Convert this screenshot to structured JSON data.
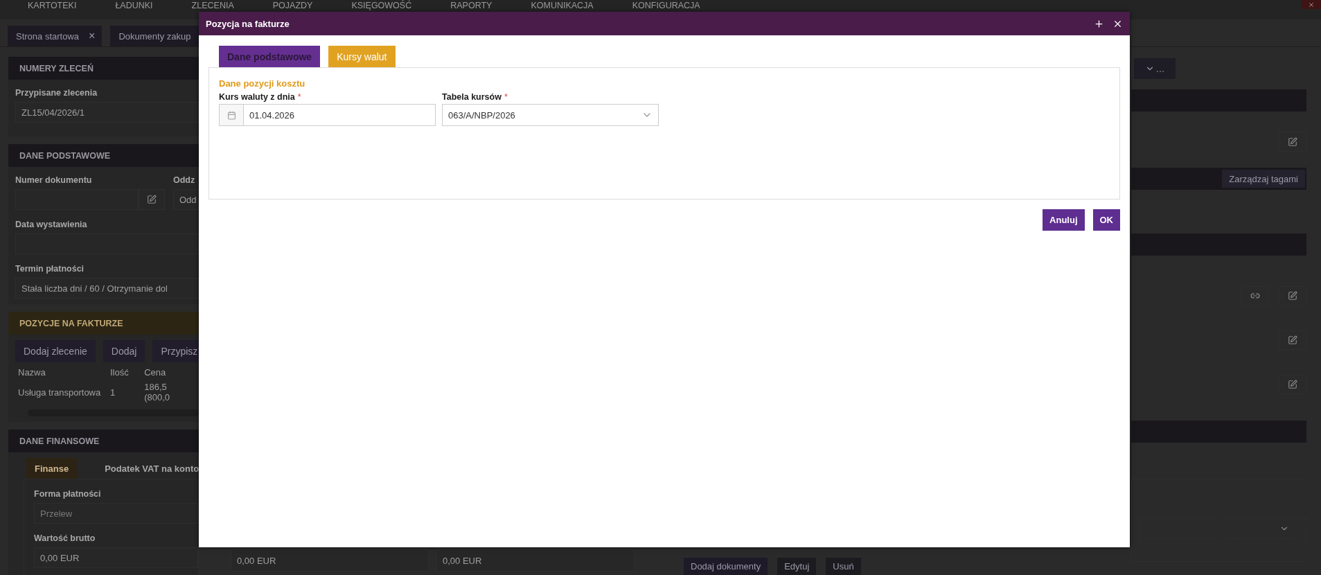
{
  "nav": {
    "items": [
      "KARTOTEKI",
      "ŁADUNKI",
      "ZLECENIA",
      "POJAZDY",
      "KSIĘGOWOŚĆ",
      "RAPORTY",
      "KOMUNIKACJA",
      "KONFIGURACJA"
    ]
  },
  "open_tabs": [
    {
      "label": "Strona startowa",
      "close": "×"
    },
    {
      "label": "Dokumenty zakup"
    }
  ],
  "orders_section": {
    "title": "NUMERY ZLECEŃ",
    "label": "Przypisane zlecenia",
    "value": "ZL15/04/2026/1"
  },
  "basic_section": {
    "title": "DANE PODSTAWOWE",
    "document_number_label": "Numer dokumentu",
    "branch_label": "Oddz",
    "branch_value": "Odd",
    "issue_date_label": "Data wystawienia",
    "payment_term_label": "Termin płatności",
    "payment_term_value": "Stała liczba dni / 60 / Otrzymanie dol"
  },
  "items_section": {
    "title": "POZYCJE NA FAKTURZE",
    "buttons": [
      "Dodaj zlecenie",
      "Dodaj",
      "Przypisz"
    ],
    "columns": [
      "Nazwa",
      "Ilość",
      "Cena"
    ],
    "rows": [
      {
        "name": "Usługa transportowa",
        "quantity": "1",
        "price_lines": [
          "186,5",
          "(800,0"
        ]
      }
    ]
  },
  "finance_section": {
    "title": "DANE FINANSOWE",
    "tabs": [
      {
        "label": "Finanse",
        "selected": true
      },
      {
        "label": "Podatek VAT na konto",
        "selected": false
      }
    ],
    "payment_form_label": "Forma płatności",
    "payment_form_value": "Przelew",
    "gross_label": "Wartość brutto",
    "gross_value": "0,00 EUR"
  },
  "bottom_strip": {
    "values": [
      "0,00 EUR",
      "0,00 EUR"
    ],
    "buttons": [
      "Dodaj dokumenty",
      "Edytuj",
      "Usuń"
    ]
  },
  "right_panel": {
    "menu_button": "…",
    "tags_button": "Zarządzaj tagami"
  },
  "dialog": {
    "title": "Pozycja na fakturze",
    "tabs": [
      {
        "label": "Dane podstawowe",
        "selected": false
      },
      {
        "label": "Kursy walut",
        "selected": true
      }
    ],
    "section_title": "Dane pozycji kosztu",
    "fields": [
      {
        "kind": "date",
        "label": "Kurs waluty z dnia",
        "required_mark": "*",
        "value": "01.04.2026"
      },
      {
        "kind": "select",
        "label": "Tabela kursów",
        "required_mark": "*",
        "value": "063/A/NBP/2026"
      }
    ],
    "buttons": [
      "Anuluj",
      "OK"
    ]
  }
}
